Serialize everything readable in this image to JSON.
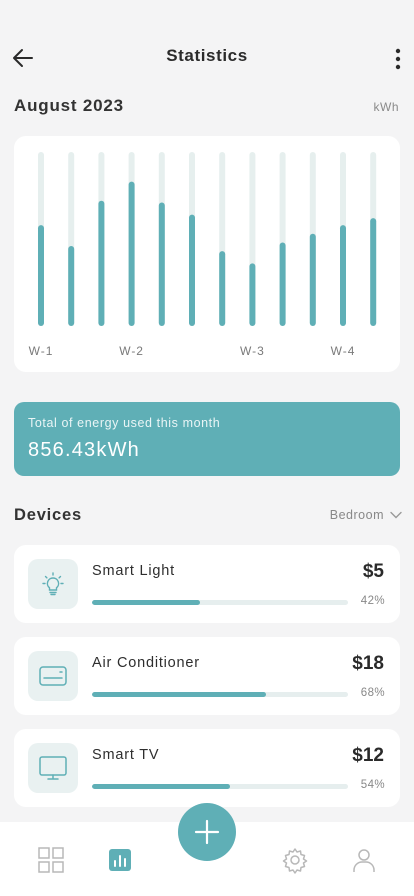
{
  "header": {
    "title": "Statistics",
    "back_icon": "arrow-left-icon",
    "menu_icon": "more-vertical-icon"
  },
  "month": {
    "title": "August 2023",
    "unit": "kWh"
  },
  "chart_data": {
    "type": "bar",
    "categories": [
      "W-1",
      "",
      "",
      "W-2",
      "",
      "",
      "",
      "W-3",
      "",
      "",
      "W-4",
      ""
    ],
    "x_tick_labels": [
      "W-1",
      "W-2",
      "W-3",
      "W-4"
    ],
    "values": [
      58,
      46,
      72,
      83,
      71,
      64,
      43,
      36,
      48,
      53,
      58,
      62
    ],
    "ylim": [
      0,
      100
    ],
    "title": "",
    "xlabel": "",
    "ylabel": "",
    "bar_color": "#5fafb6",
    "track_color": "#e6efee",
    "grid": false
  },
  "total": {
    "label": "Total of energy used this month",
    "value": "856.43kWh"
  },
  "devices": {
    "title": "Devices",
    "room": "Bedroom",
    "items": [
      {
        "name": "Smart Light",
        "cost": "$5",
        "percent_label": "42%",
        "percent": 0.42,
        "icon": "lightbulb-icon"
      },
      {
        "name": "Air Conditioner",
        "cost": "$18",
        "percent_label": "68%",
        "percent": 0.68,
        "icon": "air-conditioner-icon"
      },
      {
        "name": "Smart TV",
        "cost": "$12",
        "percent_label": "54%",
        "percent": 0.54,
        "icon": "monitor-icon"
      }
    ]
  },
  "nav": {
    "items": [
      "grid-icon",
      "bar-chart-icon",
      "settings-icon",
      "user-icon"
    ],
    "fab_icon": "plus-icon",
    "accent": "#5fafb6"
  }
}
